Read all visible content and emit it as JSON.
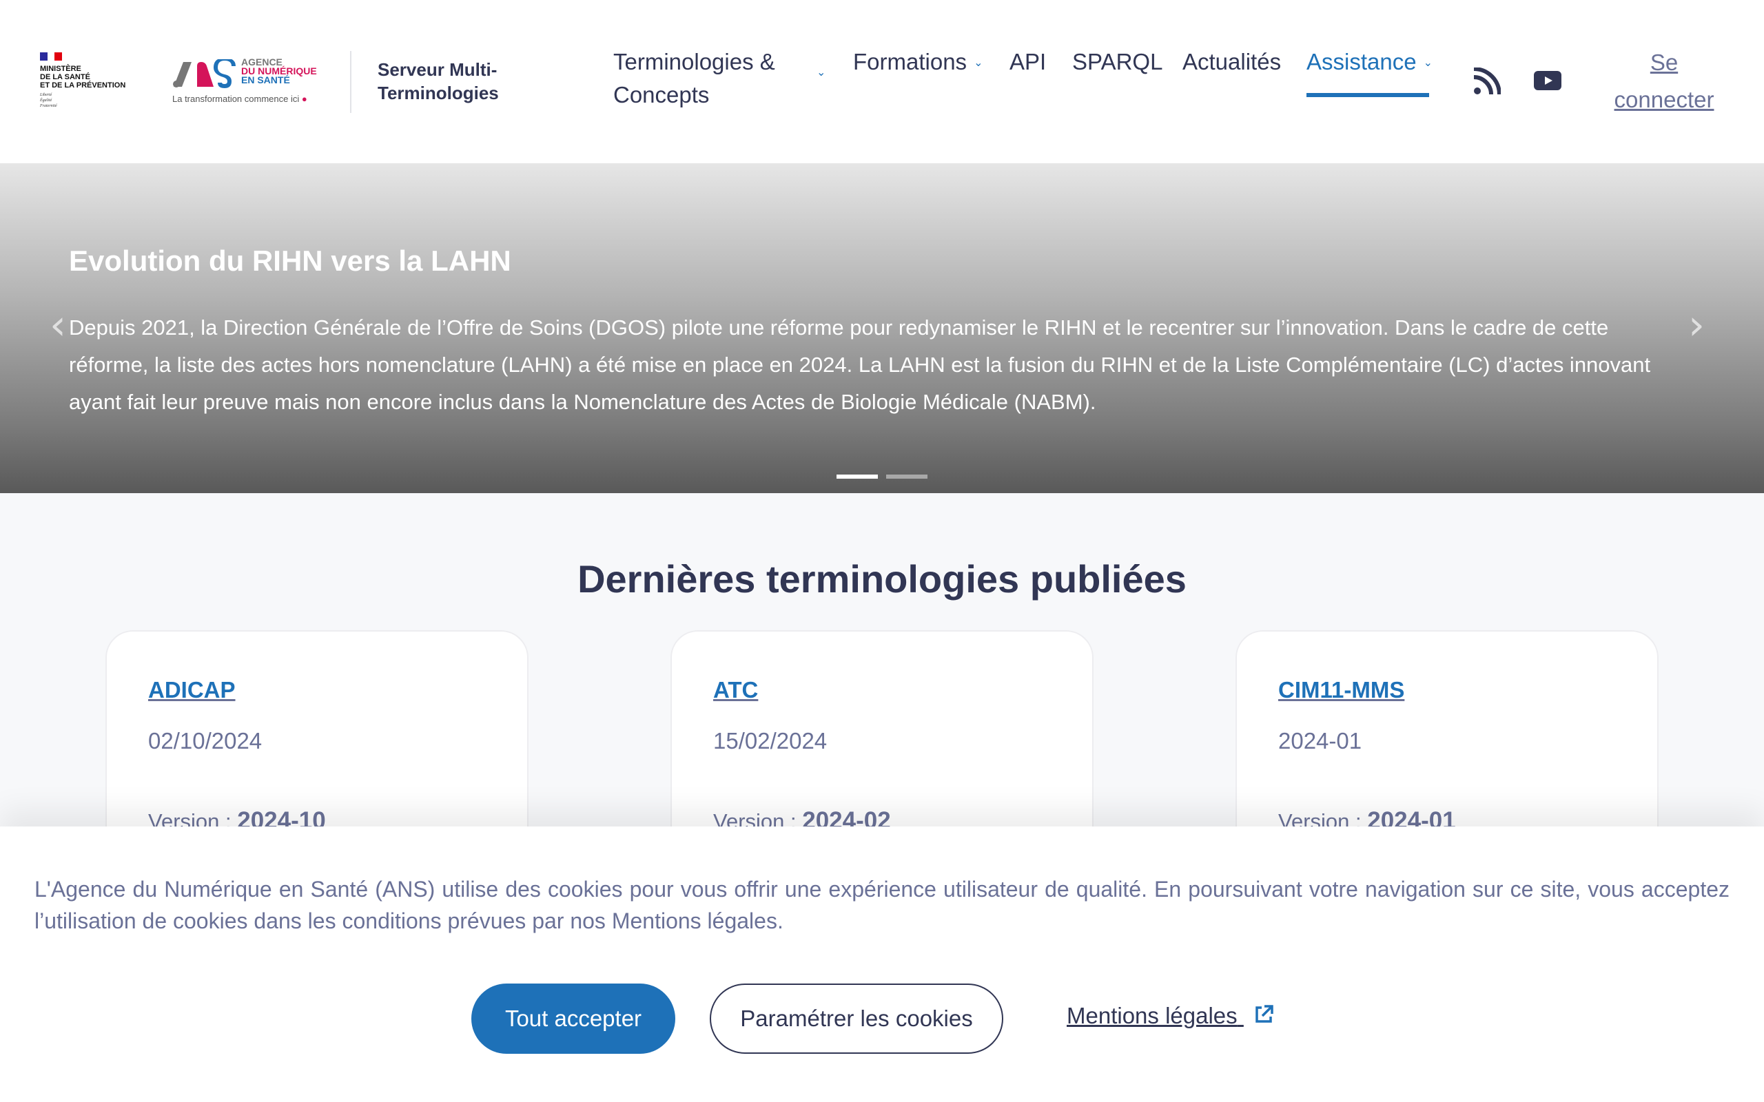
{
  "header": {
    "gov_logo": {
      "name_lines": [
        "Ministère",
        "de la santé",
        "et de la prévention"
      ],
      "motto_lines": [
        "Liberté",
        "Égalité",
        "Fraternité"
      ]
    },
    "ans_logo": {
      "line1": "AGENCE",
      "line2": "DU NUMÉRIQUE",
      "line3": "EN SANTÉ",
      "tagline": "La transformation commence ici"
    },
    "site_title_line1": "Serveur Multi-",
    "site_title_line2": "Terminologies",
    "nav": [
      {
        "label": "Terminologies & Concepts",
        "has_dropdown": true,
        "active": false
      },
      {
        "label": "Formations",
        "has_dropdown": true,
        "active": false
      },
      {
        "label": "API",
        "has_dropdown": false,
        "active": false
      },
      {
        "label": "SPARQL",
        "has_dropdown": false,
        "active": false
      },
      {
        "label": "Actualités",
        "has_dropdown": false,
        "active": false
      },
      {
        "label": "Assistance",
        "has_dropdown": true,
        "active": true
      }
    ],
    "icons": [
      "rss-icon",
      "youtube-icon"
    ],
    "login_line1": "Se",
    "login_line2": "connecter",
    "colors": {
      "accent": "#1e71b8",
      "text": "#313654",
      "muted": "#6a7197"
    }
  },
  "hero": {
    "title": "Evolution du RIHN vers la LAHN",
    "body": "Depuis 2021, la Direction Générale de l’Offre de Soins (DGOS) pilote une réforme pour redynamiser le RIHN et le recentrer sur l’innovation. Dans le cadre de cette réforme, la  liste des actes hors nomenclature (LAHN)  a été mise en place en 2024. La LAHN est la fusion du  RIHN et de la Liste Complémentaire (LC) d’actes innovant ayant fait leur preuve mais non encore inclus dans la Nomenclature des Actes de Biologie Médicale (NABM).",
    "prev_glyph": "‹",
    "next_glyph": "›",
    "slide_count": 2,
    "active_slide": 1
  },
  "section": {
    "title": "Dernières terminologies publiées",
    "cards": [
      {
        "title": "ADICAP",
        "date": "02/10/2024",
        "version_label": "Version : ",
        "version": "2024-10"
      },
      {
        "title": "ATC",
        "date": "15/02/2024",
        "version_label": "Version : ",
        "version": "2024-02"
      },
      {
        "title": "CIM11-MMS",
        "date": "2024-01",
        "version_label": "Version : ",
        "version": "2024-01"
      }
    ]
  },
  "cookie_banner": {
    "text": "L'Agence du Numérique en Santé (ANS) utilise des cookies pour vous offrir une expérience utilisateur de qualité. En poursuivant votre navigation sur ce site, vous acceptez l’utilisation de cookies dans les conditions prévues par nos Mentions légales.",
    "accept_label": "Tout accepter",
    "settings_label": "Paramétrer les cookies",
    "legal_label": "Mentions légales"
  }
}
